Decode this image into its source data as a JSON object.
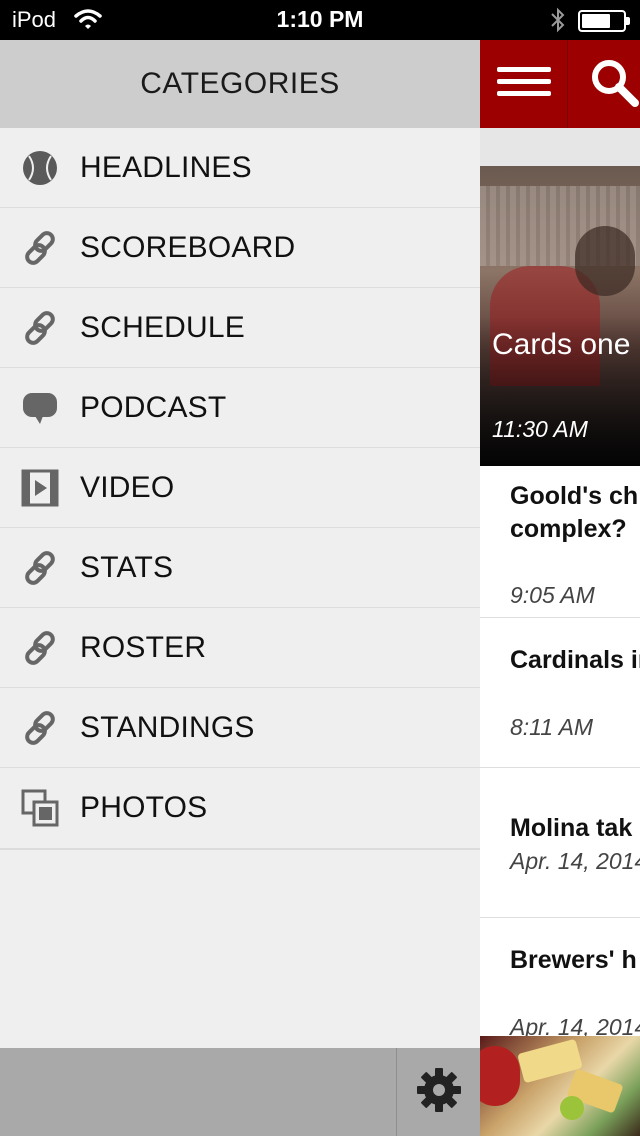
{
  "status_bar": {
    "carrier": "iPod",
    "time": "1:10 PM"
  },
  "sidebar": {
    "title": "CATEGORIES",
    "items": [
      {
        "label": "HEADLINES",
        "icon": "baseball-icon"
      },
      {
        "label": "SCOREBOARD",
        "icon": "link-icon"
      },
      {
        "label": "SCHEDULE",
        "icon": "link-icon"
      },
      {
        "label": "PODCAST",
        "icon": "speech-bubble-icon"
      },
      {
        "label": "VIDEO",
        "icon": "film-icon"
      },
      {
        "label": "STATS",
        "icon": "link-icon"
      },
      {
        "label": "ROSTER",
        "icon": "link-icon"
      },
      {
        "label": "STANDINGS",
        "icon": "link-icon"
      },
      {
        "label": "PHOTOS",
        "icon": "photos-icon"
      }
    ],
    "footer": {
      "settings_icon": "gear-icon"
    }
  },
  "main": {
    "toolbar_color": "#9c0000",
    "hero": {
      "title": "Cards one players",
      "time": "11:30 AM"
    },
    "stories": [
      {
        "title": "Goold's ch get over it complex?",
        "time": "9:05 AM"
      },
      {
        "title": "Cardinals infielder E",
        "time": "8:11 AM"
      },
      {
        "title": "Molina tak",
        "time": "Apr. 14, 2014"
      },
      {
        "title": "Brewers' h different v",
        "time": "Apr. 14, 2014"
      }
    ]
  },
  "colors": {
    "accent": "#9c0000",
    "sidebar_bg": "#efefef",
    "sidebar_header_bg": "#cdcdcd",
    "footer_bg": "#a9a9a9"
  }
}
